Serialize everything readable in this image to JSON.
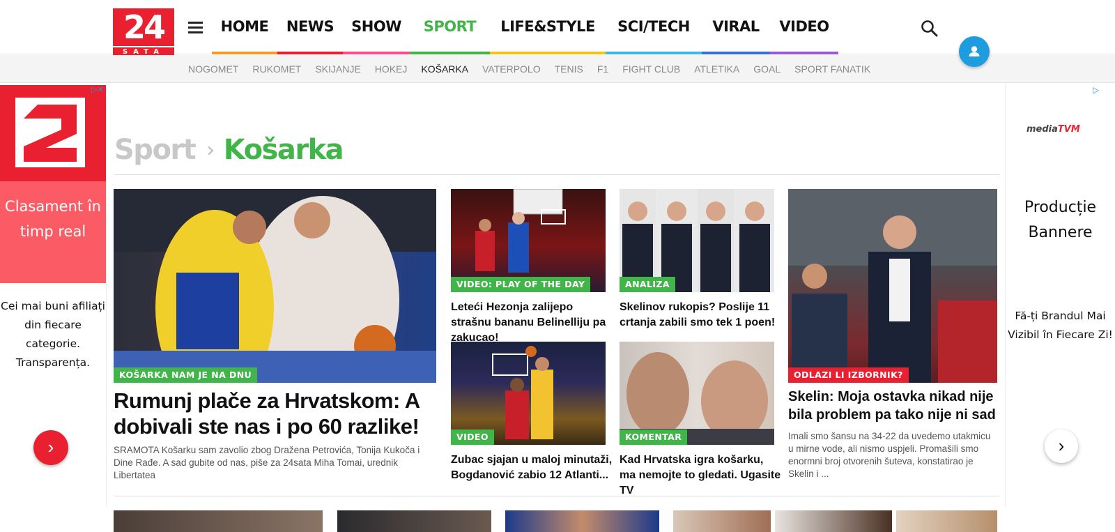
{
  "header": {
    "logo_number": "24",
    "logo_sub": "SATA",
    "nav": [
      {
        "label": "HOME",
        "color": "#f39c29",
        "active": false
      },
      {
        "label": "NEWS",
        "color": "#e8202f",
        "active": false
      },
      {
        "label": "SHOW",
        "color": "#ff4c8f",
        "active": false
      },
      {
        "label": "SPORT",
        "color": "#41b44a",
        "active": true
      },
      {
        "label": "LIFE&STYLE",
        "color": "#f5c11a",
        "active": false
      },
      {
        "label": "SCI/TECH",
        "color": "#3db6ea",
        "active": false
      },
      {
        "label": "VIRAL",
        "color": "#3a6fd8",
        "active": false
      },
      {
        "label": "VIDEO",
        "color": "#9b59d6",
        "active": false
      }
    ],
    "accent": "#41b44a"
  },
  "subnav": [
    {
      "label": "NOGOMET",
      "active": false
    },
    {
      "label": "RUKOMET",
      "active": false
    },
    {
      "label": "SKIJANJE",
      "active": false
    },
    {
      "label": "HOKEJ",
      "active": false
    },
    {
      "label": "KOŠARKA",
      "active": true
    },
    {
      "label": "VATERPOLO",
      "active": false
    },
    {
      "label": "TENIS",
      "active": false
    },
    {
      "label": "F1",
      "active": false
    },
    {
      "label": "FIGHT CLUB",
      "active": false
    },
    {
      "label": "ATLETIKA",
      "active": false
    },
    {
      "label": "GOAL",
      "active": false
    },
    {
      "label": "SPORT FANATIK",
      "active": false
    }
  ],
  "breadcrumb": {
    "root": "Sport",
    "separator": "›",
    "current": "Košarka"
  },
  "ad_left": {
    "adchoice": "▷✕",
    "logo_digit": "2",
    "promo": "Clasament în timp real",
    "description": "Cei mai buni afiliați din fiecare categorie. Transparența.",
    "button_glyph": "›"
  },
  "ad_right": {
    "adchoice": "▷",
    "brand_prefix": "media",
    "brand_suffix": "TVM",
    "title": "Producție Bannere",
    "description": "Fă-ți Brandul Mai Vizibil în Fiecare Zi!",
    "button_glyph": "›"
  },
  "articles": {
    "main": {
      "tag": "KOŠARKA NAM JE NA DNU",
      "headline": "Rumunj plače za Hrvatskom: A dobivali ste nas i po 60 razlike!",
      "teaser": "SRAMOTA Košarku sam zavolio zbog Dražena Petrovića, Tonija Kukoča i Dine Rađe. A sad gubite od nas, piše za 24sata Miha Tomai, urednik Libertatea"
    },
    "a2": {
      "tag": "VIDEO: PLAY OF THE DAY",
      "headline": "Leteći Hezonja zalijepo strašnu bananu Belinelliju pa zakucao!"
    },
    "a3": {
      "tag": "VIDEO",
      "headline": "Zubac sjajan u maloj minutaži, Bogdanović zabio 12 Atlanti..."
    },
    "a4": {
      "tag": "ANALIZA",
      "headline": "Skelinov rukopis? Poslije 11 crtanja zabili smo tek 1 poen!"
    },
    "a5": {
      "tag": "KOMENTAR",
      "headline": "Kad Hrvatska igra košarku, ma nemojte to gledati. Ugasite TV"
    },
    "a6": {
      "tag": "ODLAZI LI IZBORNIK?",
      "headline": "Skelin: Moja ostavka nikad nije bila problem pa tako nije ni sad",
      "teaser": "Imali smo šansu na 34-22 da uvedemo utakmicu u mirne vode, ali nismo uspjeli. Promašili smo enormni broj otvorenih šuteva, konstatirao je Skelin i ..."
    }
  },
  "colors": {
    "sport_green": "#41b44a",
    "red": "#e8202f",
    "user_blue": "#1e9cde"
  }
}
